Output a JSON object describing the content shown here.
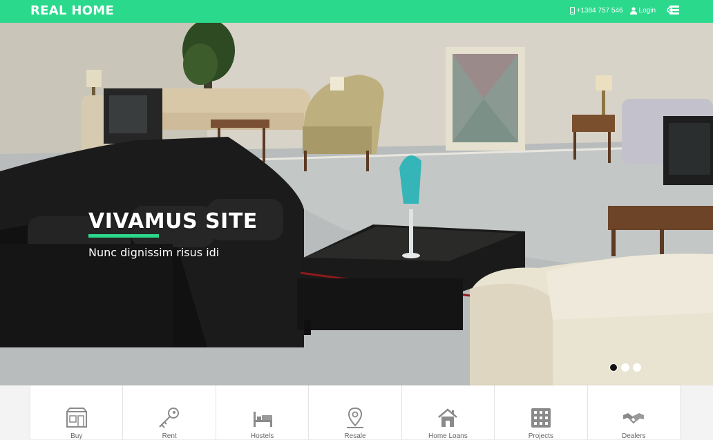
{
  "header": {
    "brand": "REAL HOME",
    "phone": "+1384 757 546",
    "login": "Login",
    "icons": [
      "phone-icon",
      "user-icon",
      "search-icon",
      "menu-icon"
    ],
    "accent_color": "#2bd98d"
  },
  "hero": {
    "title": "VIVAMUS SITE",
    "subtitle": "Nunc dignissim risus idi",
    "slide_count": 3,
    "active_slide": 1
  },
  "categories": [
    {
      "label": "Buy",
      "icon": "store-icon"
    },
    {
      "label": "Rent",
      "icon": "key-icon"
    },
    {
      "label": "Hostels",
      "icon": "bed-icon"
    },
    {
      "label": "Resale",
      "icon": "map-pin-icon"
    },
    {
      "label": "Home Loans",
      "icon": "house-icon"
    },
    {
      "label": "Projects",
      "icon": "building-icon"
    },
    {
      "label": "Dealers",
      "icon": "handshake-icon"
    }
  ]
}
